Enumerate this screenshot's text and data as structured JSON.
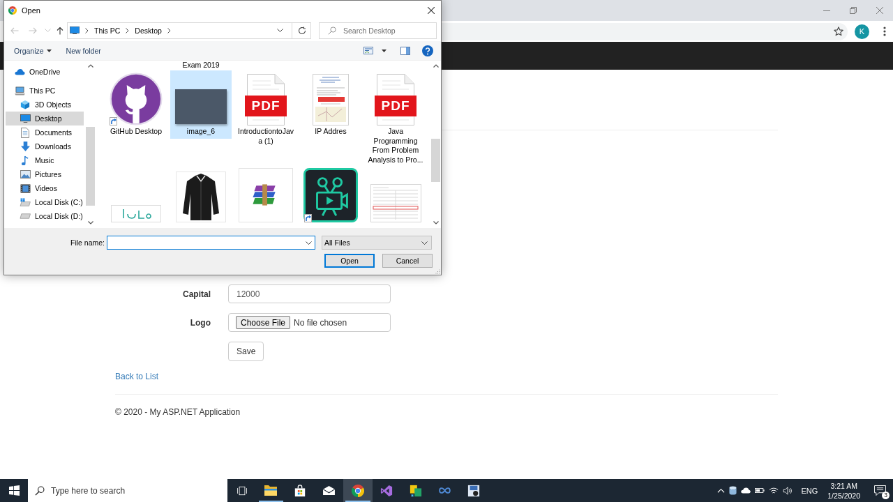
{
  "browser": {
    "profile_initial": "K"
  },
  "page": {
    "fields": [
      {
        "kind": "text",
        "label": "Capital",
        "value": "12000"
      },
      {
        "kind": "file",
        "label": "Logo",
        "button": "Choose File",
        "status": "No file chosen"
      }
    ],
    "save_button": "Save",
    "back_link": "Back to List",
    "footer": "© 2020 - My ASP.NET Application"
  },
  "dialog": {
    "title": "Open",
    "history": [
      {
        "kind": "back",
        "disabled": true
      },
      {
        "kind": "forward",
        "disabled": true
      },
      {
        "kind": "recent",
        "disabled": true
      },
      {
        "kind": "up",
        "disabled": false
      }
    ],
    "path": [
      "This PC",
      "Desktop"
    ],
    "search_placeholder": "Search Desktop",
    "toolbar": [
      {
        "label": "Organize",
        "menu": true
      },
      {
        "label": "New folder",
        "menu": false
      }
    ],
    "nav": [
      {
        "label": "OneDrive",
        "kind": "cloud",
        "selected": false
      },
      {
        "label": "This PC",
        "kind": "computer",
        "selected": false,
        "children": [
          {
            "label": "3D Objects",
            "kind": "cube",
            "selected": false
          },
          {
            "label": "Desktop",
            "kind": "desktop",
            "selected": true
          },
          {
            "label": "Documents",
            "kind": "documents",
            "selected": false
          },
          {
            "label": "Downloads",
            "kind": "downloads",
            "selected": false
          },
          {
            "label": "Music",
            "kind": "music",
            "selected": false
          },
          {
            "label": "Pictures",
            "kind": "pictures",
            "selected": false
          },
          {
            "label": "Videos",
            "kind": "videos",
            "selected": false
          },
          {
            "label": "Local Disk (C:)",
            "kind": "system-drive",
            "selected": false
          },
          {
            "label": "Local Disk (D:)",
            "kind": "drive",
            "selected": false
          }
        ]
      }
    ],
    "partial_label": "Exam 2019",
    "files": [
      {
        "name": "GitHub Desktop",
        "kind": "github",
        "selected": false,
        "shortcut": true
      },
      {
        "name": "image_6",
        "kind": "photo",
        "selected": true,
        "shortcut": false
      },
      {
        "name": "IntroductiontoJava (1)",
        "kind": "pdf",
        "badge": "PDF",
        "selected": false,
        "shortcut": false
      },
      {
        "name": "IP Addres",
        "kind": "page-preview",
        "selected": false,
        "shortcut": false
      },
      {
        "name": "Java Programming From Problem Analysis to Pro...",
        "kind": "pdf",
        "badge": "PDF",
        "selected": false,
        "shortcut": false
      },
      {
        "kind": "logo-image",
        "selected": false,
        "shortcut": false
      },
      {
        "kind": "shirt-photo",
        "selected": false,
        "shortcut": false
      },
      {
        "kind": "archive",
        "selected": false,
        "shortcut": false
      },
      {
        "kind": "video-editor",
        "selected": false,
        "shortcut": true
      },
      {
        "kind": "table-preview",
        "selected": false,
        "shortcut": false
      }
    ],
    "file_name_label": "File name:",
    "file_name_focused": true,
    "filter": "All Files",
    "buttons": [
      {
        "label": "Open",
        "default": true
      },
      {
        "label": "Cancel",
        "default": false
      }
    ]
  },
  "taskbar": {
    "search_placeholder": "Type here to search",
    "apps": [
      {
        "kind": "task-view",
        "running": false,
        "selected": false
      },
      {
        "kind": "file-explorer",
        "running": true,
        "selected": false
      },
      {
        "kind": "store",
        "running": false,
        "selected": false
      },
      {
        "kind": "mail",
        "running": false,
        "selected": false
      },
      {
        "kind": "chrome",
        "running": true,
        "selected": true
      },
      {
        "kind": "visual-studio",
        "running": false,
        "selected": false
      },
      {
        "kind": "office-app",
        "running": false,
        "selected": false
      },
      {
        "kind": "infinity",
        "running": false,
        "selected": false
      },
      {
        "kind": "disk-app",
        "running": false,
        "selected": false
      }
    ],
    "language": "ENG",
    "time": "3:21 AM",
    "date": "1/25/2020",
    "notification_count": "3"
  }
}
